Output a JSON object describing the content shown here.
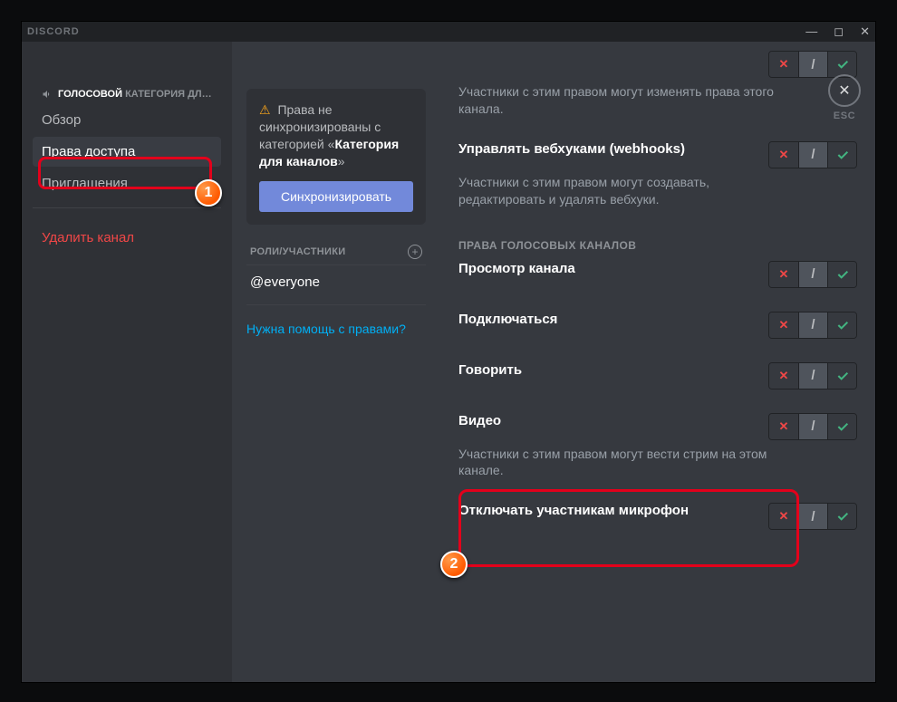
{
  "titlebar": {
    "brand": "DISCORD"
  },
  "esc": {
    "label": "ESC"
  },
  "sidebar": {
    "category_prefix": "ГОЛОСОВОЙ",
    "category_suffix": "КАТЕГОРИЯ ДЛ…",
    "items": [
      {
        "label": "Обзор"
      },
      {
        "label": "Права доступа"
      },
      {
        "label": "Приглашения"
      }
    ],
    "delete": "Удалить канал"
  },
  "sync": {
    "text_pre": "Права не синхронизированы с категорией «",
    "category": "Категория для каналов",
    "text_post": "»",
    "button": "Синхронизировать"
  },
  "roles": {
    "header": "РОЛИ/УЧАСТНИКИ",
    "items": [
      "@everyone"
    ],
    "help": "Нужна помощь с правами?"
  },
  "main": {
    "top_desc": "Участники с этим правом могут изменять права этого канала.",
    "perm0": {
      "title": "Управлять вебхуками (webhooks)",
      "desc": "Участники с этим правом могут создавать, редактировать и удалять вебхуки."
    },
    "section": "ПРАВА ГОЛОСОВЫХ КАНАЛОВ",
    "perm1": {
      "title": "Просмотр канала"
    },
    "perm2": {
      "title": "Подключаться"
    },
    "perm3": {
      "title": "Говорить"
    },
    "perm4": {
      "title": "Видео",
      "desc": "Участники с этим правом могут вести стрим на этом канале."
    },
    "perm5": {
      "title": "Отключать участникам микрофон"
    }
  }
}
